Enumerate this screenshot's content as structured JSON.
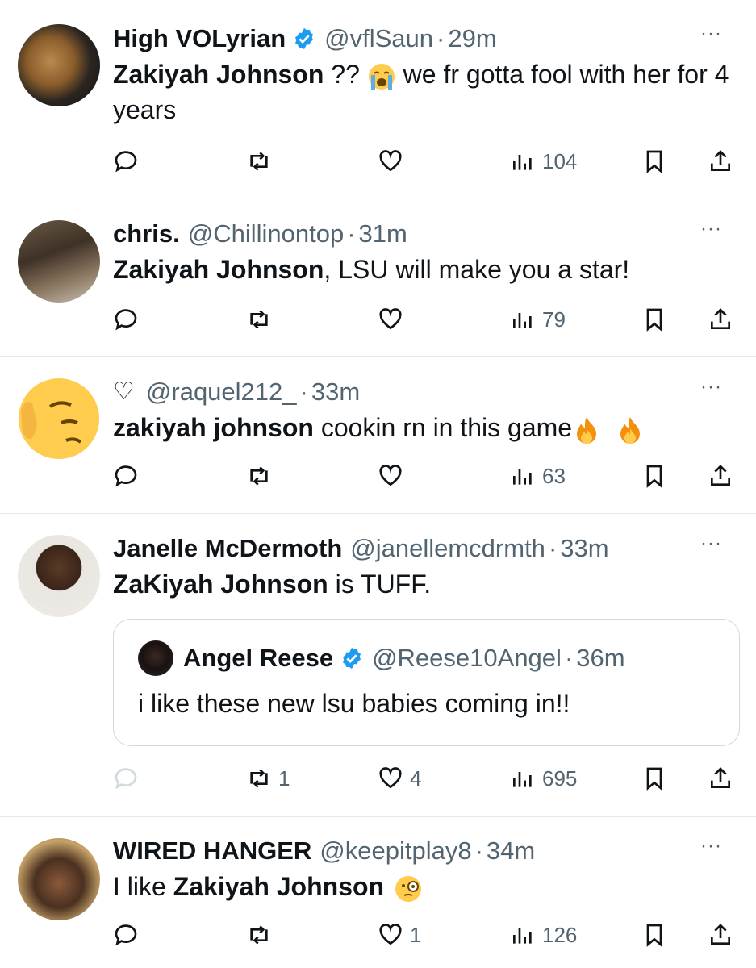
{
  "icons": {
    "reply": "reply-icon",
    "retweet": "retweet-icon",
    "like": "heart-icon",
    "views": "views-icon",
    "bookmark": "bookmark-icon",
    "share": "share-icon",
    "more": "more-icon",
    "verified": "verified-badge-icon"
  },
  "colors": {
    "text": "#0f1419",
    "muted": "#536471",
    "verified": "#1d9bf0",
    "divider": "#e6e9ec"
  },
  "tweets": [
    {
      "name": "High VOLyrian",
      "handle": "@vflSaun",
      "dot": "·",
      "time": "29m",
      "more": "···",
      "text_bold": "Zakiyah Johnson",
      "text_mid": " ?? ",
      "text_end": " we fr gotta fool with her for 4 years",
      "emoji": "loudly-crying-face",
      "views": "104"
    },
    {
      "name": "chris.",
      "handle": "@Chillinontop",
      "dot": "·",
      "time": "31m",
      "more": "···",
      "text_bold": "Zakiyah Johnson",
      "text_end": ", LSU will make you a star!",
      "views": "79"
    },
    {
      "name": "♡",
      "handle": "@raquel212_",
      "dot": "·",
      "time": "33m",
      "more": "···",
      "text_bold": "zakiyah johnson",
      "text_end": " cookin rn in this game",
      "emoji": "fire",
      "views": "63"
    },
    {
      "name": "Janelle McDermoth",
      "handle": "@janellemcdrmth",
      "dot": "·",
      "time": "33m",
      "more": "···",
      "text_bold": "ZaKiyah Johnson",
      "text_end": " is TUFF.",
      "quote": {
        "name": "Angel Reese",
        "handle": "@Reese10Angel",
        "dot": "·",
        "time": "36m",
        "text": "i like these new lsu babies coming in!!"
      },
      "retweets": "1",
      "likes": "4",
      "views": "695"
    },
    {
      "name": "WIRED HANGER",
      "handle": "@keepitplay8",
      "dot": "·",
      "time": "34m",
      "more": "···",
      "text_start": "I like ",
      "text_bold": "Zakiyah Johnson",
      "emoji": "face-with-monocle",
      "likes": "1",
      "views": "126"
    }
  ]
}
